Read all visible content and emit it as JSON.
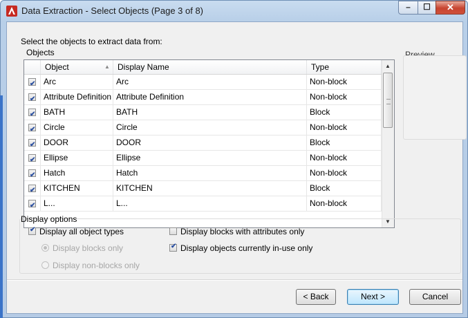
{
  "window": {
    "title": "Data Extraction - Select Objects (Page 3 of 8)",
    "controls": {
      "minimize": "–",
      "maximize": "☐",
      "close": "✕"
    }
  },
  "prompt": "Select the objects to extract data from:",
  "objects_group_label": "Objects",
  "preview_label": "Preview",
  "grid": {
    "columns": [
      "Object",
      "Display Name",
      "Type"
    ],
    "rows": [
      {
        "checked": true,
        "object": "Arc",
        "display_name": "Arc",
        "type": "Non-block"
      },
      {
        "checked": true,
        "object": "Attribute Definition",
        "display_name": "Attribute Definition",
        "type": "Non-block"
      },
      {
        "checked": true,
        "object": "BATH",
        "display_name": "BATH",
        "type": "Block"
      },
      {
        "checked": true,
        "object": "Circle",
        "display_name": "Circle",
        "type": "Non-block"
      },
      {
        "checked": true,
        "object": "DOOR",
        "display_name": "DOOR",
        "type": "Block"
      },
      {
        "checked": true,
        "object": "Ellipse",
        "display_name": "Ellipse",
        "type": "Non-block"
      },
      {
        "checked": true,
        "object": "Hatch",
        "display_name": "Hatch",
        "type": "Non-block"
      },
      {
        "checked": true,
        "object": "KITCHEN",
        "display_name": "KITCHEN",
        "type": "Block"
      },
      {
        "checked": true,
        "object": "L...",
        "display_name": "L...",
        "type": "Non-block"
      }
    ]
  },
  "display_options": {
    "label": "Display options",
    "all_types": {
      "label": "Display all object types",
      "checked": true
    },
    "blocks_only": {
      "label": "Display blocks only",
      "selected": true,
      "enabled": false
    },
    "non_blocks_only": {
      "label": "Display non-blocks only",
      "selected": false,
      "enabled": false
    },
    "attributes_only": {
      "label": "Display blocks with attributes only",
      "checked": false
    },
    "in_use_only": {
      "label": "Display objects currently in-use only",
      "checked": true
    }
  },
  "buttons": {
    "back": "< Back",
    "next": "Next >",
    "cancel": "Cancel"
  },
  "colors": {
    "accent": "#3c7fb1",
    "title_bar": "#b8cfe8",
    "close": "#c74430"
  }
}
